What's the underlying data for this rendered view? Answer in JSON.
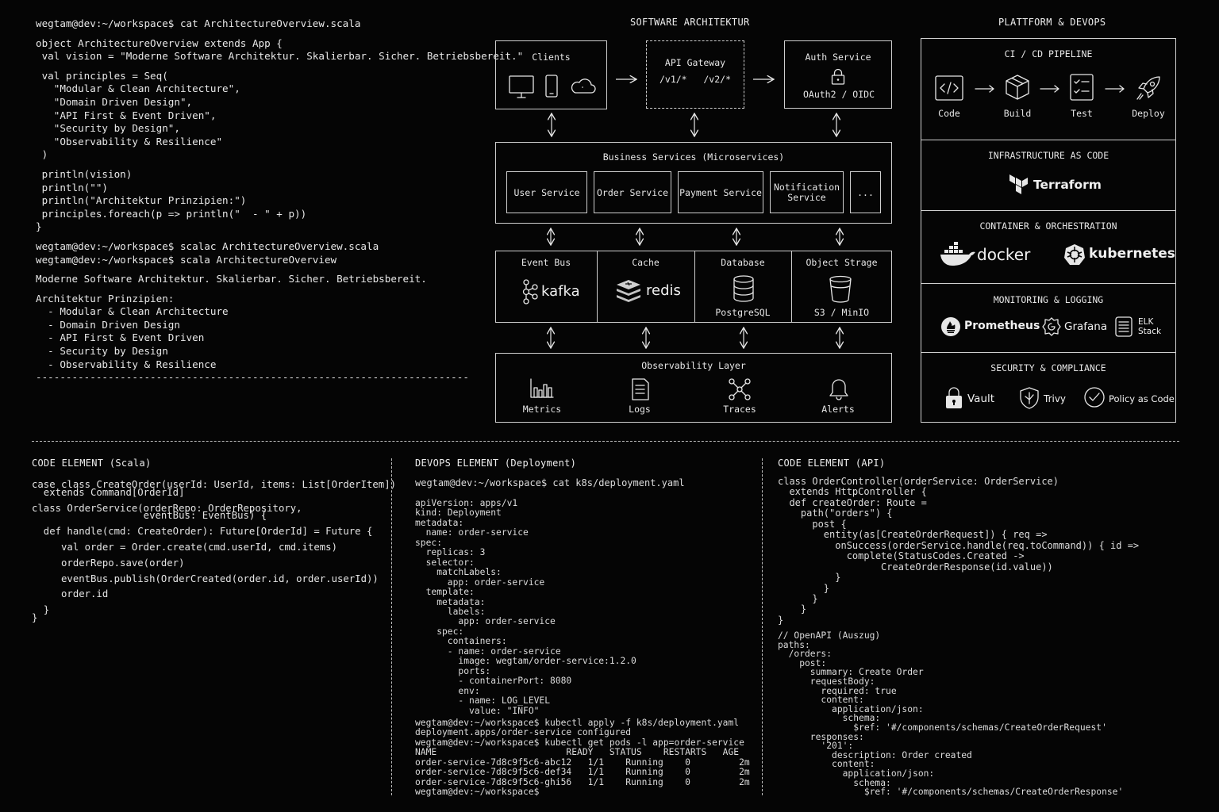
{
  "terminal": {
    "lines": [
      "wegtam@dev:~/workspace$ cat ArchitectureOverview.scala",
      "",
      "object ArchitectureOverview extends App {",
      " val vision = \"Moderne Software Architektur. Skalierbar. Sicher. Betriebsbereit.\"",
      "",
      " val principles = Seq(",
      "   \"Modular & Clean Architecture\",",
      "   \"Domain Driven Design\",",
      "   \"API First & Event Driven\",",
      "   \"Security by Design\",",
      "   \"Observability & Resilience\"",
      " )",
      "",
      " println(vision)",
      " println(\"\")",
      " println(\"Architektur Prinzipien:\")",
      " principles.foreach(p => println(\"  - \" + p))",
      "}",
      "",
      "wegtam@dev:~/workspace$ scalac ArchitectureOverview.scala",
      "wegtam@dev:~/workspace$ scala ArchitectureOverview",
      "",
      "Moderne Software Architektur. Skalierbar. Sicher. Betriebsbereit.",
      "",
      "Architektur Prinzipien:",
      "  - Modular & Clean Architecture",
      "  - Domain Driven Design",
      "  - API First & Event Driven",
      "  - Security by Design",
      "  - Observability & Resilience",
      "------------------------------------------------------------------------"
    ]
  },
  "architecture": {
    "title": "SOFTWARE ARCHITEKTUR",
    "clients": {
      "label": "Clients",
      "icons": [
        "monitor-icon",
        "phone-icon",
        "cloud-icon"
      ]
    },
    "gateway": {
      "label": "API Gateway",
      "routes": "/v1/*   /v2/*"
    },
    "auth": {
      "label": "Auth Service",
      "sub": "OAuth2 / OIDC",
      "icon": "lock-icon"
    },
    "business": {
      "label": "Business Services (Microservices)",
      "services": [
        "User Service",
        "Order Service",
        "Payment Service",
        "Notification\nService",
        "..."
      ]
    },
    "infra": [
      {
        "label": "Event Bus",
        "brand": "kafka",
        "icon": "kafka-icon",
        "sub": ""
      },
      {
        "label": "Cache",
        "brand": "redis",
        "icon": "redis-icon",
        "sub": ""
      },
      {
        "label": "Database",
        "brand": "",
        "icon": "database-icon",
        "sub": "PostgreSQL"
      },
      {
        "label": "Object Strage",
        "brand": "",
        "icon": "bucket-icon",
        "sub": "S3 / MinIO"
      }
    ],
    "observability": {
      "label": "Observability Layer",
      "items": [
        {
          "label": "Metrics",
          "icon": "bar-chart-icon"
        },
        {
          "label": "Logs",
          "icon": "document-icon"
        },
        {
          "label": "Traces",
          "icon": "graph-nodes-icon"
        },
        {
          "label": "Alerts",
          "icon": "bell-icon"
        }
      ]
    }
  },
  "platform": {
    "title": "PLATTFORM & DEVOPS",
    "cicd": {
      "title": "CI / CD PIPELINE",
      "steps": [
        {
          "label": "Code",
          "icon": "code-icon"
        },
        {
          "label": "Build",
          "icon": "cube-icon"
        },
        {
          "label": "Test",
          "icon": "checklist-icon"
        },
        {
          "label": "Deploy",
          "icon": "rocket-icon"
        }
      ]
    },
    "iac": {
      "title": "INFRASTRUCTURE AS CODE",
      "tool": "Terraform"
    },
    "container": {
      "title": "CONTAINER & ORCHESTRATION",
      "tools": [
        "docker",
        "kubernetes"
      ]
    },
    "monitoring": {
      "title": "MONITORING & LOGGING",
      "tools": [
        "Prometheus",
        "Grafana"
      ],
      "elk": [
        "ELK",
        "Stack"
      ]
    },
    "security": {
      "title": "SECURITY & COMPLIANCE",
      "tools": [
        "Vault",
        "Trivy",
        "Policy as Code"
      ]
    }
  },
  "bottom": {
    "scala": {
      "title": "CODE ELEMENT (Scala)",
      "lines": [
        "case class CreateOrder(userId: UserId, items: List[OrderItem])",
        "  extends Command[OrderId]",
        "",
        "class OrderService(orderRepo: OrderRepository,",
        "                   eventBus: EventBus) {",
        "",
        "  def handle(cmd: CreateOrder): Future[OrderId] = Future {",
        "",
        "     val order = Order.create(cmd.userId, cmd.items)",
        "",
        "     orderRepo.save(order)",
        "",
        "     eventBus.publish(OrderCreated(order.id, order.userId))",
        "",
        "     order.id",
        "",
        "  }",
        "}"
      ]
    },
    "devops": {
      "title": "DEVOPS ELEMENT (Deployment)",
      "prompt": "wegtam@dev:~/workspace$ cat k8s/deployment.yaml",
      "yaml": [
        "apiVersion: apps/v1",
        "kind: Deployment",
        "metadata:",
        "  name: order-service",
        "spec:",
        "  replicas: 3",
        "  selector:",
        "    matchLabels:",
        "      app: order-service",
        "  template:",
        "    metadata:",
        "      labels:",
        "        app: order-service",
        "    spec:",
        "      containers:",
        "      - name: order-service",
        "        image: wegtam/order-service:1.2.0",
        "        ports:",
        "        - containerPort: 8080",
        "        env:",
        "        - name: LOG_LEVEL",
        "          value: \"INFO\""
      ],
      "output": [
        "wegtam@dev:~/workspace$ kubectl apply -f k8s/deployment.yaml",
        "deployment.apps/order-service configured",
        "wegtam@dev:~/workspace$ kubectl get pods -l app=order-service",
        "NAME                        READY   STATUS    RESTARTS   AGE",
        "order-service-7d8c9f5c6-abc12   1/1    Running    0         2m",
        "order-service-7d8c9f5c6-def34   1/1    Running    0         2m",
        "order-service-7d8c9f5c6-ghi56   1/1    Running    0         2m",
        "wegtam@dev:~/workspace$"
      ]
    },
    "api": {
      "title": "CODE ELEMENT (API)",
      "code": [
        "class OrderController(orderService: OrderService)",
        "  extends HttpController {",
        "  def createOrder: Route =",
        "    path(\"orders\") {",
        "      post {",
        "        entity(as[CreateOrderRequest]) { req =>",
        "          onSuccess(orderService.handle(req.toCommand)) { id =>",
        "            complete(StatusCodes.Created ->",
        "                  CreateOrderResponse(id.value))",
        "          }",
        "        }",
        "      }",
        "    }",
        "}"
      ],
      "openapi": [
        "// OpenAPI (Auszug)",
        "paths:",
        "  /orders:",
        "    post:",
        "      summary: Create Order",
        "      requestBody:",
        "        required: true",
        "        content:",
        "          application/json:",
        "            schema:",
        "              $ref: '#/components/schemas/CreateOrderRequest'",
        "      responses:",
        "        '201':",
        "          description: Order created",
        "          content:",
        "            application/json:",
        "              schema:",
        "                $ref: '#/components/schemas/CreateOrderResponse'"
      ]
    }
  }
}
